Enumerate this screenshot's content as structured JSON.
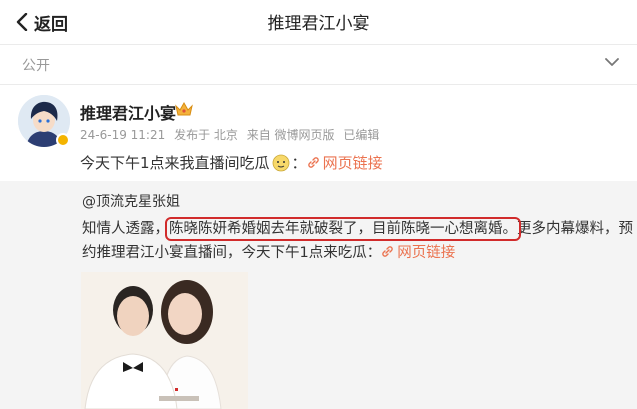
{
  "nav": {
    "back_label": "返回",
    "title": "推理君江小宴"
  },
  "visibility": {
    "label": "公开"
  },
  "post": {
    "author": "推理君江小宴",
    "date": "24-6-19 11:21",
    "source": "发布于 北京",
    "client": "来自 微博网页版",
    "edited": "已编辑",
    "text": "今天下午1点来我直播间吃瓜",
    "link_label": "网页链接"
  },
  "repost": {
    "author": "@顶流克星张姐",
    "line1_before": "知情人透露，",
    "line1_highlight": "陈晓陈妍希婚姻去年就破裂了，目前陈晓一心想离婚。",
    "line1_after": "更多内幕爆料，预",
    "line2_text": "约推理君江小宴直播间，今天下午1点来吃瓜：",
    "link_label": "网页链接"
  },
  "colors": {
    "link": "#eb7350",
    "highlight_border": "#d12b2b",
    "repost_bg": "#f4f4f4"
  }
}
